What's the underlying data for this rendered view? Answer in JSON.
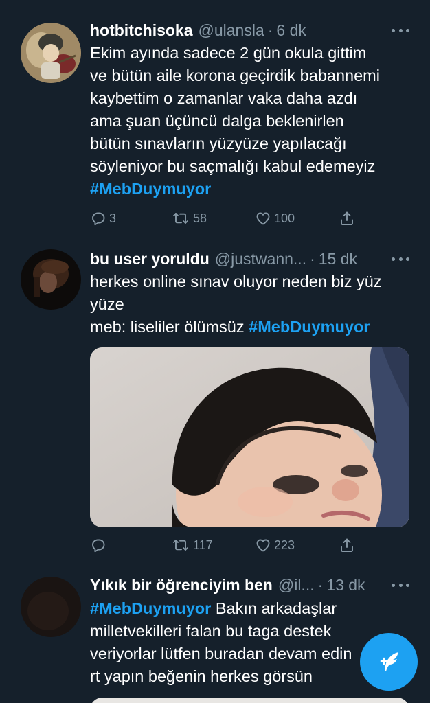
{
  "tweets": [
    {
      "name": "hotbitchisoka",
      "handle": "@ulansla",
      "dot": "·",
      "time": "6 dk",
      "lines": [
        "Ekim ayında sadece 2 gün okula gittim",
        "ve bütün aile korona geçirdik babannemi",
        "kaybettim o zamanlar vaka daha azdı",
        "ama şuan üçüncü dalga beklenirlen",
        "bütün sınavların yüzyüze yapılacağı",
        "söyleniyor bu saçmalığı kabul edemeyiz"
      ],
      "hashtag": "#MebDuymuyor",
      "replies": "3",
      "retweets": "58",
      "likes": "100"
    },
    {
      "name": "bu user yoruldu",
      "handle": "@justwann...",
      "dot": "·",
      "time": "15 dk",
      "line1": "herkes online sınav oluyor neden biz yüz",
      "line2": "yüze",
      "line3_text": "meb: liseliler ölümsüz ",
      "hashtag": "#MebDuymuyor",
      "replies": "",
      "retweets": "117",
      "likes": "223"
    },
    {
      "name": "Yıkık bir öğrenciyim ben",
      "handle": "@il...",
      "dot": "·",
      "time": "13 dk",
      "hashtag": "#MebDuymuyor",
      "line1_text": " Bakın arkadaşlar",
      "line2": "milletvekilleri falan bu taga destek",
      "line3": "veriyorlar lütfen buradan devam edin",
      "line4": "rt yapın beğenin herkes görsün"
    }
  ],
  "icons": {
    "reply": "reply-icon",
    "retweet": "retweet-icon",
    "like": "heart-icon",
    "share": "share-icon",
    "more": "more-icon",
    "compose": "compose-tweet-icon"
  },
  "colors": {
    "background": "#15202b",
    "accent": "#1da1f2",
    "muted": "#8899a6",
    "divider": "#38444d"
  }
}
